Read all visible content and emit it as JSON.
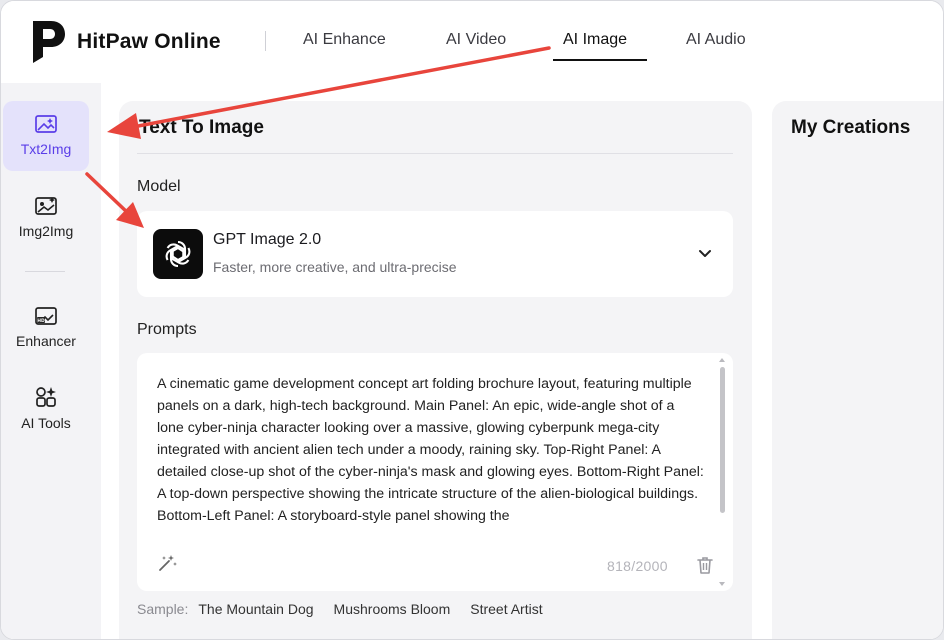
{
  "brand": {
    "name": "HitPaw Online"
  },
  "nav": [
    {
      "label": "AI Enhance",
      "active": false
    },
    {
      "label": "AI Video",
      "active": false
    },
    {
      "label": "AI Image",
      "active": true
    },
    {
      "label": "AI Audio",
      "active": false
    }
  ],
  "sidebar": {
    "items": [
      {
        "label": "Txt2Img",
        "icon": "text-to-image-icon",
        "active": true
      },
      {
        "label": "Img2Img",
        "icon": "image-to-image-icon",
        "active": false
      },
      {
        "label": "Enhancer",
        "icon": "hd-enhance-icon",
        "active": false
      },
      {
        "label": "AI Tools",
        "icon": "ai-tools-icon",
        "active": false
      }
    ]
  },
  "main": {
    "title": "Text To Image",
    "model_label": "Model",
    "model": {
      "name": "GPT Image 2.0",
      "description": "Faster, more creative, and ultra-precise",
      "icon": "openai-icon"
    },
    "prompts_label": "Prompts",
    "prompt_text": "A cinematic game development concept art folding brochure layout, featuring multiple panels on a dark, high-tech background. Main Panel: An epic, wide-angle shot of a lone cyber-ninja character looking over a massive, glowing cyberpunk mega-city integrated with ancient alien tech under a moody, raining sky. Top-Right Panel: A detailed close-up shot of the cyber-ninja's mask and glowing eyes. Bottom-Right Panel: A top-down perspective showing the intricate structure of the alien-biological buildings. Bottom-Left Panel: A storyboard-style panel showing the",
    "char_count": "818/2000",
    "sample_label": "Sample:",
    "samples": [
      "The Mountain Dog",
      "Mushrooms Bloom",
      "Street Artist"
    ]
  },
  "creations": {
    "title": "My Creations"
  },
  "colors": {
    "accent": "#5a3ee8",
    "active_bg": "#e4e2fb",
    "annotation_arrow": "#e8453c"
  }
}
